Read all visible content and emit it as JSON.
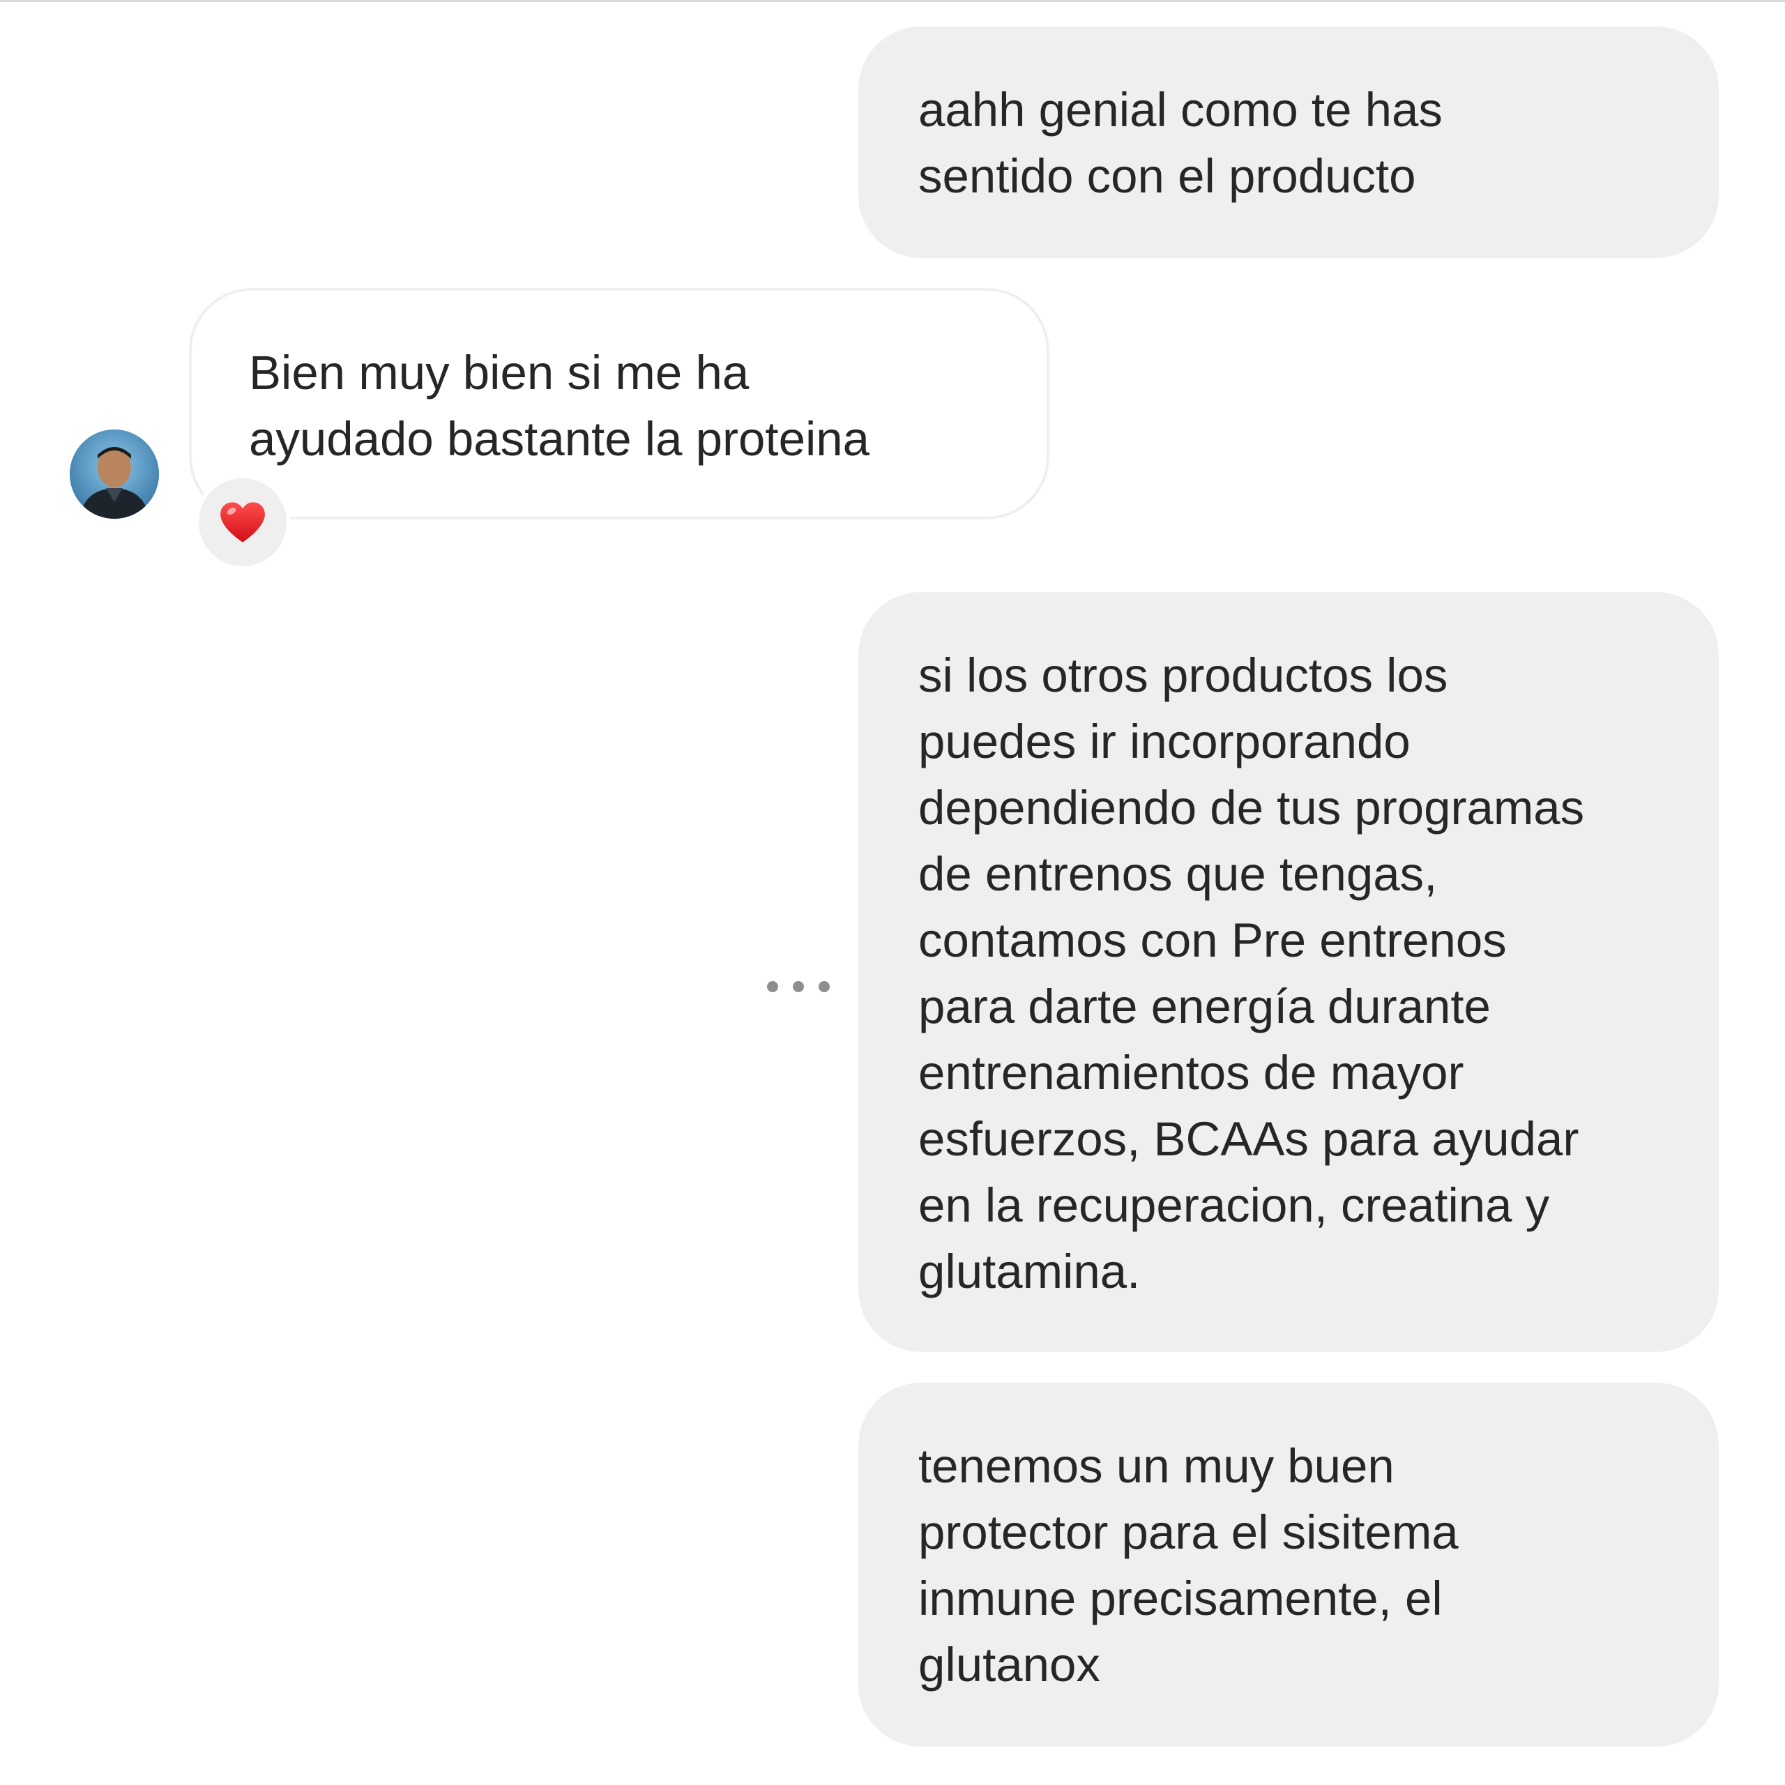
{
  "conversation": {
    "messages": [
      {
        "direction": "outgoing",
        "lines": [
          "aahh genial como te has",
          "sentido con el producto"
        ]
      },
      {
        "direction": "incoming",
        "lines": [
          "Bien muy bien si me ha",
          "ayudado bastante la proteina"
        ],
        "reaction": "heart"
      },
      {
        "direction": "outgoing",
        "lines": [
          "si los otros productos los",
          "puedes ir incorporando",
          "dependiendo de tus programas",
          "de entrenos que tengas,",
          "contamos con Pre entrenos",
          "para darte energía durante",
          "entrenamientos de mayor",
          "esfuerzos, BCAAs para ayudar",
          "en la recuperacion, creatina y",
          "glutamina."
        ]
      },
      {
        "direction": "outgoing",
        "lines": [
          "tenemos un muy buen",
          "protector para el sisitema",
          "inmune precisamente, el",
          "glutanox"
        ]
      }
    ]
  },
  "colors": {
    "outgoing_bubble": "#efefef",
    "incoming_border": "#efefef",
    "text": "#262626",
    "reaction_heart": "#e0191f"
  },
  "icons": {
    "reaction": "heart-icon",
    "more": "more-options-icon",
    "avatar": "contact-avatar"
  }
}
